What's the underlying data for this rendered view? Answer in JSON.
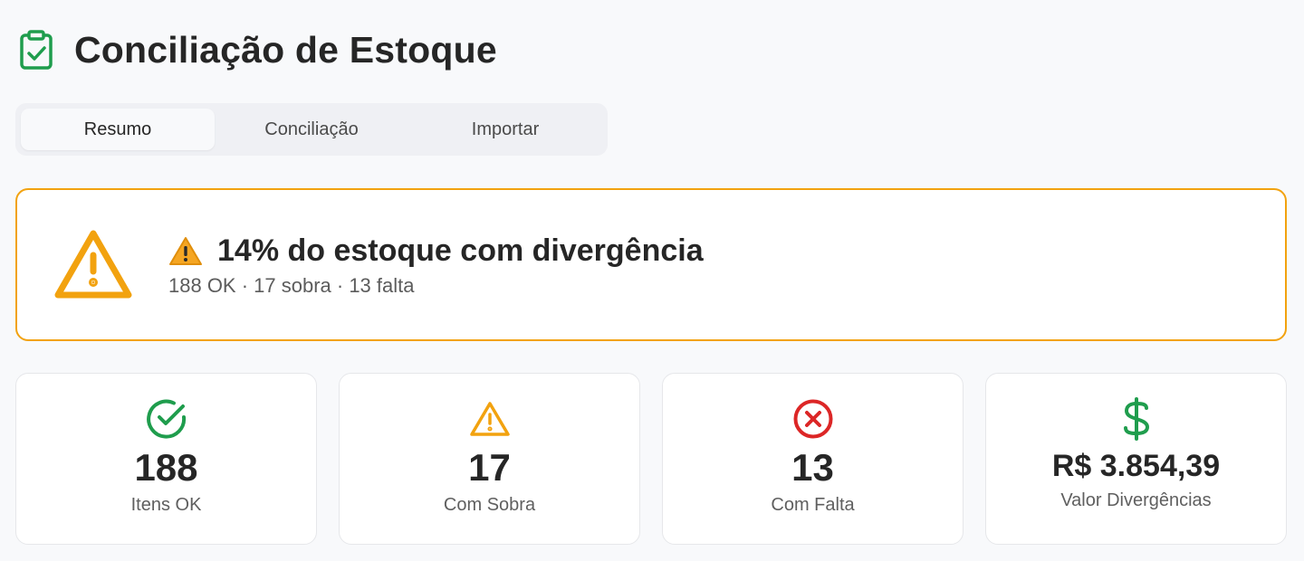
{
  "page": {
    "title": "Conciliação de Estoque",
    "icon": "clipboard-check-icon"
  },
  "tabs": [
    {
      "label": "Resumo",
      "active": true
    },
    {
      "label": "Conciliação",
      "active": false
    },
    {
      "label": "Importar",
      "active": false
    }
  ],
  "alert": {
    "icon": "warning-triangle-icon",
    "emoji": "warning-emoji-icon",
    "title": "14% do estoque com divergência",
    "subtitle": "188 OK · 17 sobra · 13 falta",
    "border_color": "#f2a20f"
  },
  "cards": [
    {
      "icon": "check-circle-icon",
      "value": "188",
      "label": "Itens OK",
      "color": "#1f9d4d"
    },
    {
      "icon": "warning-triangle-icon",
      "value": "17",
      "label": "Com Sobra",
      "color": "#f2a20f"
    },
    {
      "icon": "x-circle-icon",
      "value": "13",
      "label": "Com Falta",
      "color": "#dc2626"
    },
    {
      "icon": "dollar-icon",
      "value": "R$ 3.854,39",
      "label": "Valor Divergências",
      "color": "#1f9d4d"
    }
  ]
}
